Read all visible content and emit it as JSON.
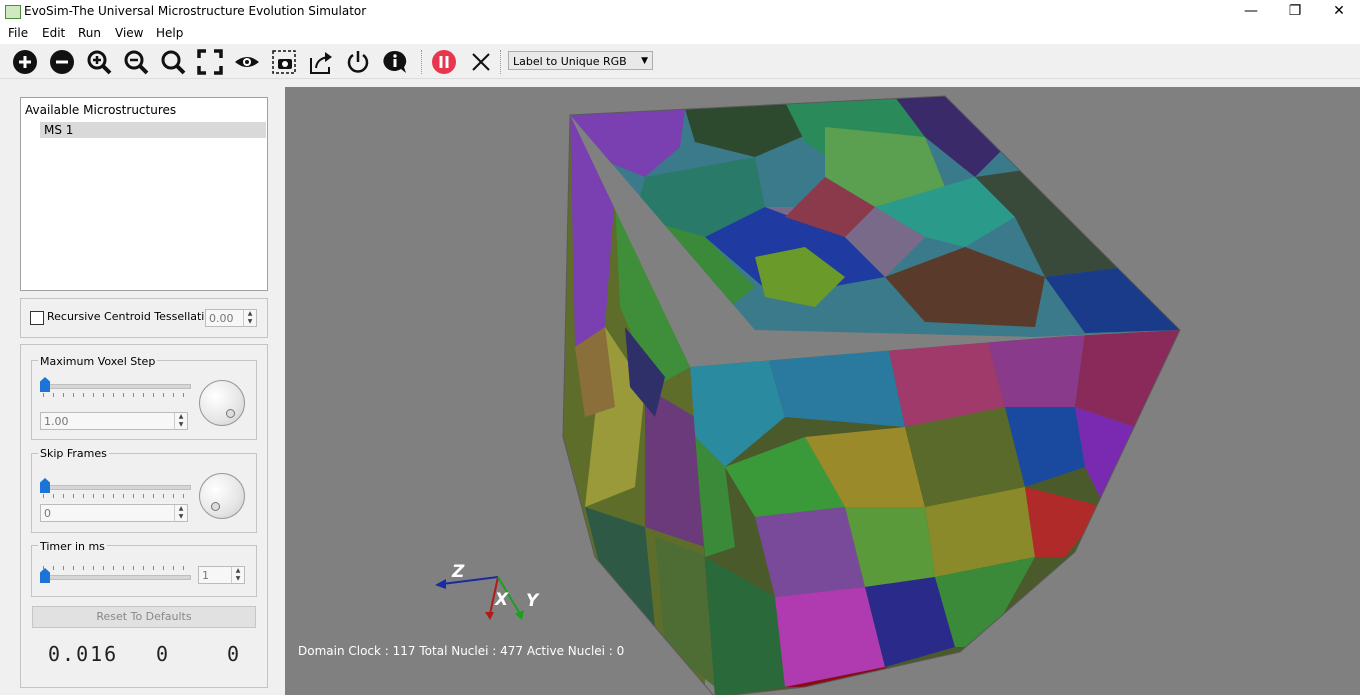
{
  "window": {
    "title": "EvoSim-The Universal Microstructure Evolution Simulator",
    "minimize": "—",
    "restore": "❐",
    "close": "✕"
  },
  "menu": [
    "File",
    "Edit",
    "Run",
    "View",
    "Help"
  ],
  "toolbar": {
    "buttons": [
      "add-icon",
      "remove-icon",
      "zoom-in-icon",
      "zoom-out-icon",
      "search-icon",
      "fit-view-icon",
      "visibility-eye-icon",
      "screenshot-camera-icon",
      "export-icon",
      "power-icon",
      "info-icon",
      "pause-icon",
      "close-icon"
    ],
    "color_mode": "Label to Unique RGB",
    "pause_color": "#e8364f"
  },
  "sidebar": {
    "list_title": "Available Microstructures",
    "items": [
      "MS 1"
    ],
    "recursive_label": "Recursive Centroid Tessellation",
    "recursive_value": "0.00",
    "max_voxel_label": "Maximum Voxel Step",
    "max_voxel_value": "1.00",
    "skip_frames_label": "Skip Frames",
    "skip_frames_value": "0",
    "timer_label": "Timer in ms",
    "timer_value": "1",
    "reset_label": "Reset To Defaults",
    "lcd": [
      "0.016",
      "0",
      "0"
    ]
  },
  "viewport": {
    "status": "Domain Clock : 117  Total Nuclei : 477  Active Nuclei : 0",
    "axis_labels": {
      "z": "Z",
      "x": "X",
      "y": "Y"
    }
  }
}
